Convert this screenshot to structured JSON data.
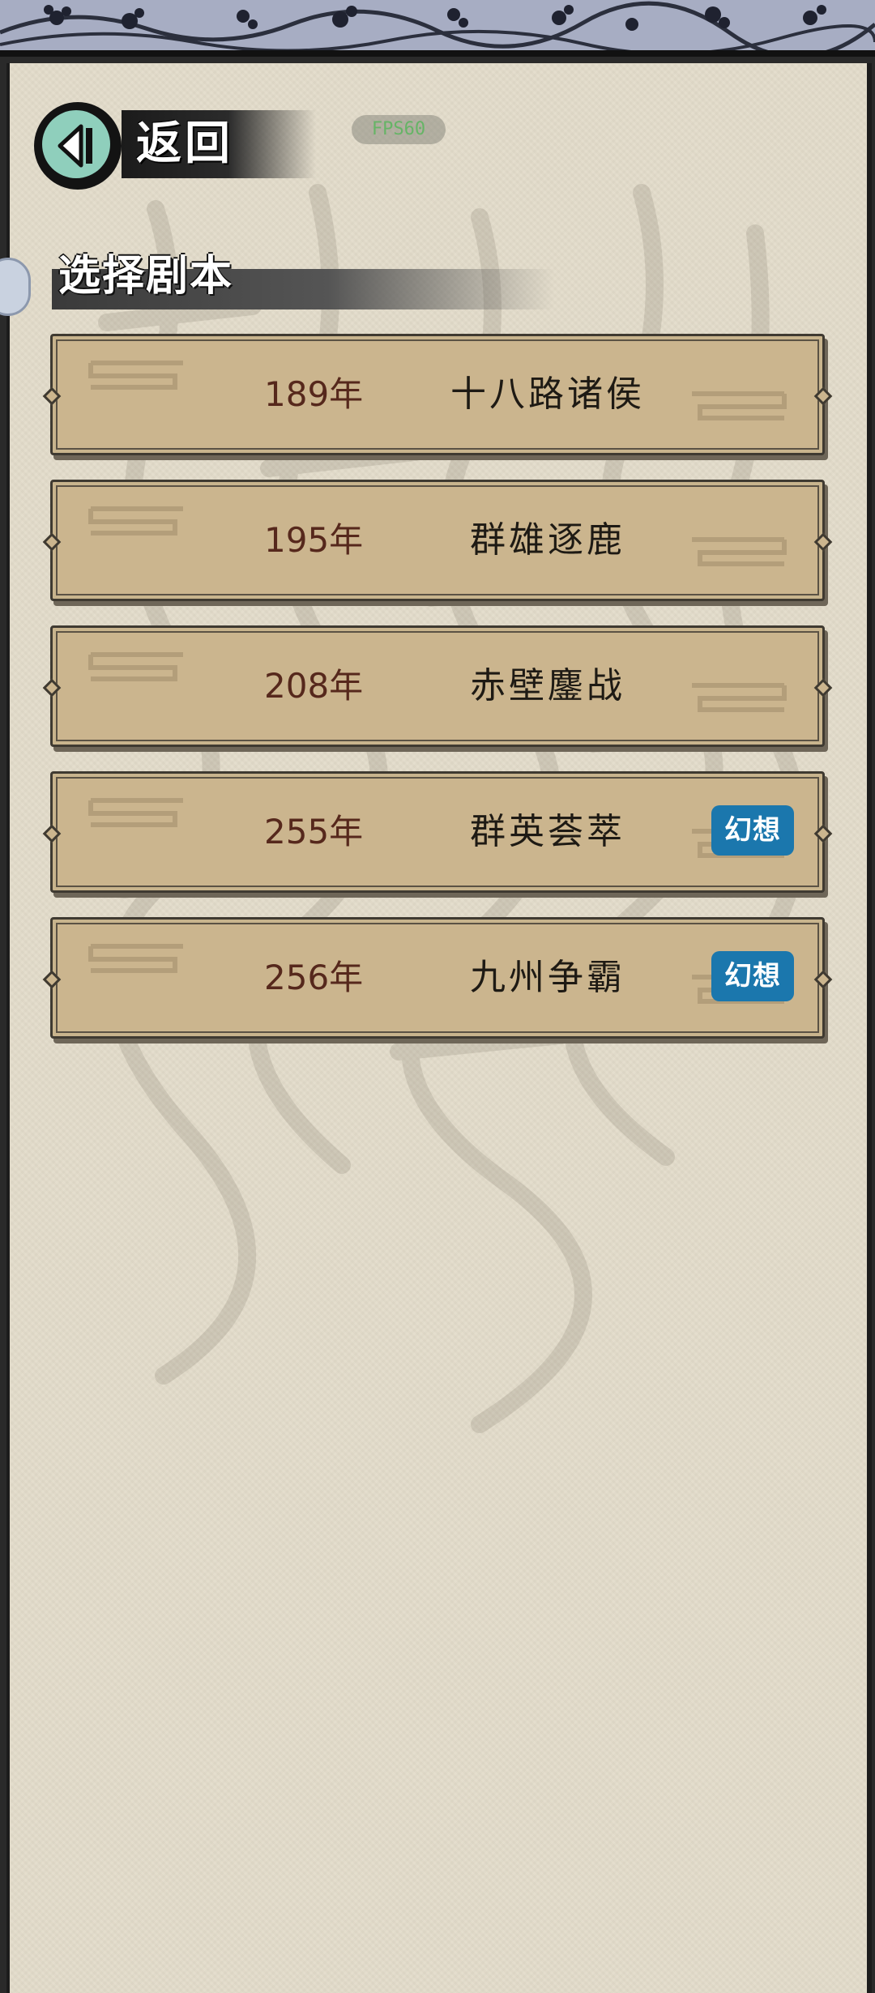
{
  "header": {
    "back_label": "返回",
    "fps_label": "FPS60"
  },
  "section": {
    "title": "选择剧本"
  },
  "scenarios": [
    {
      "year": "189年",
      "name": "十八路诸侯",
      "tag": ""
    },
    {
      "year": "195年",
      "name": "群雄逐鹿",
      "tag": ""
    },
    {
      "year": "208年",
      "name": "赤壁鏖战",
      "tag": ""
    },
    {
      "year": "255年",
      "name": "群英荟萃",
      "tag": "幻想"
    },
    {
      "year": "256年",
      "name": "九州争霸",
      "tag": "幻想"
    }
  ],
  "colors": {
    "paper": "#e3dccb",
    "card": "#cbb58e",
    "year_text": "#56281c",
    "tag_bg": "#1b77ad",
    "top_band": "#a7adc3"
  },
  "icons": {
    "back": "back-arrow-icon",
    "card_deco": "scroll-ornament-icon"
  }
}
